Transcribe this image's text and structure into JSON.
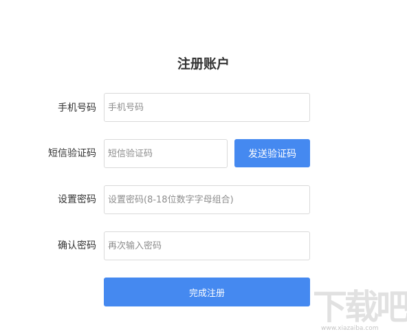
{
  "form": {
    "title": "注册账户",
    "phone": {
      "label": "手机号码",
      "placeholder": "手机号码"
    },
    "sms_code": {
      "label": "短信验证码",
      "placeholder": "短信验证码",
      "send_button": "发送验证码"
    },
    "password": {
      "label": "设置密码",
      "placeholder": "设置密码(8-18位数字字母组合)"
    },
    "confirm_password": {
      "label": "确认密码",
      "placeholder": "再次输入密码"
    },
    "submit_button": "完成注册"
  },
  "watermark": {
    "text": "下载吧",
    "url": "www.xiazaiba.com"
  },
  "colors": {
    "accent": "#4589f0",
    "border": "#d9d9d9",
    "text": "#333333",
    "placeholder": "#8c8c8c"
  }
}
